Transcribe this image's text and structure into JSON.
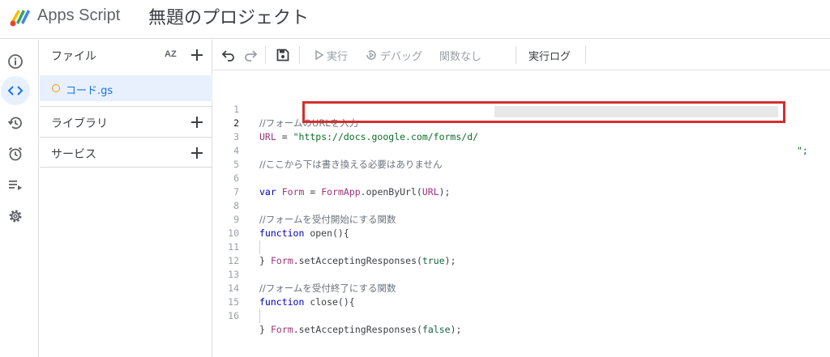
{
  "header": {
    "app_name": "Apps Script",
    "project_title": "無題のプロジェクト"
  },
  "rail": {
    "items": [
      "info-icon",
      "code-icon",
      "history-icon",
      "alarm-icon",
      "executions-icon",
      "settings-icon"
    ],
    "active": "code-icon"
  },
  "files": {
    "title": "ファイル",
    "sort_icon_text": "AZ",
    "items": [
      {
        "name": "コード.gs"
      }
    ],
    "library_label": "ライブラリ",
    "services_label": "サービス"
  },
  "toolbar": {
    "run_label": "実行",
    "debug_label": "デバッグ",
    "function_label": "関数なし",
    "log_label": "実行ログ"
  },
  "editor": {
    "line_numbers": [
      "1",
      "2",
      "3",
      "4",
      "5",
      "6",
      "7",
      "8",
      "9",
      "10",
      "11",
      "12",
      "13",
      "14",
      "15",
      "16"
    ],
    "comment1": "//フォームのURLを入力",
    "l2_var": "URL",
    "l2_eq": " = ",
    "l2_q1": "\"",
    "l2_url": "https://docs.google.com/forms/d/",
    "l2_end": "\";",
    "comment2": "//ここから下は書き換える必要はありません",
    "l6_kw": "var",
    "l6_var": "Form",
    "l6_eq": " = ",
    "l6_obj": "FormApp",
    "l6_call": ".openByUrl(",
    "l6_arg": "URL",
    "l6_end": ");",
    "comment3": "//フォームを受付開始にする関数",
    "l9_kw": "function",
    "l9_name": " open(){",
    "l10_obj": "Form",
    "l10_call": ".setAcceptingResponses(",
    "l10_arg": "true",
    "l10_end": ");",
    "brace": "}",
    "comment4": "//フォームを受付終了にする関数",
    "l14_kw": "function",
    "l14_name": " close(){",
    "l15_obj": "Form",
    "l15_call": ".setAcceptingResponses(",
    "l15_arg": "false",
    "l15_end": ");"
  },
  "colors": {
    "accent": "#1a73e8",
    "active_bg": "#e8f0fe",
    "highlight_border": "#d32f2f",
    "file_dot": "#f29900"
  }
}
